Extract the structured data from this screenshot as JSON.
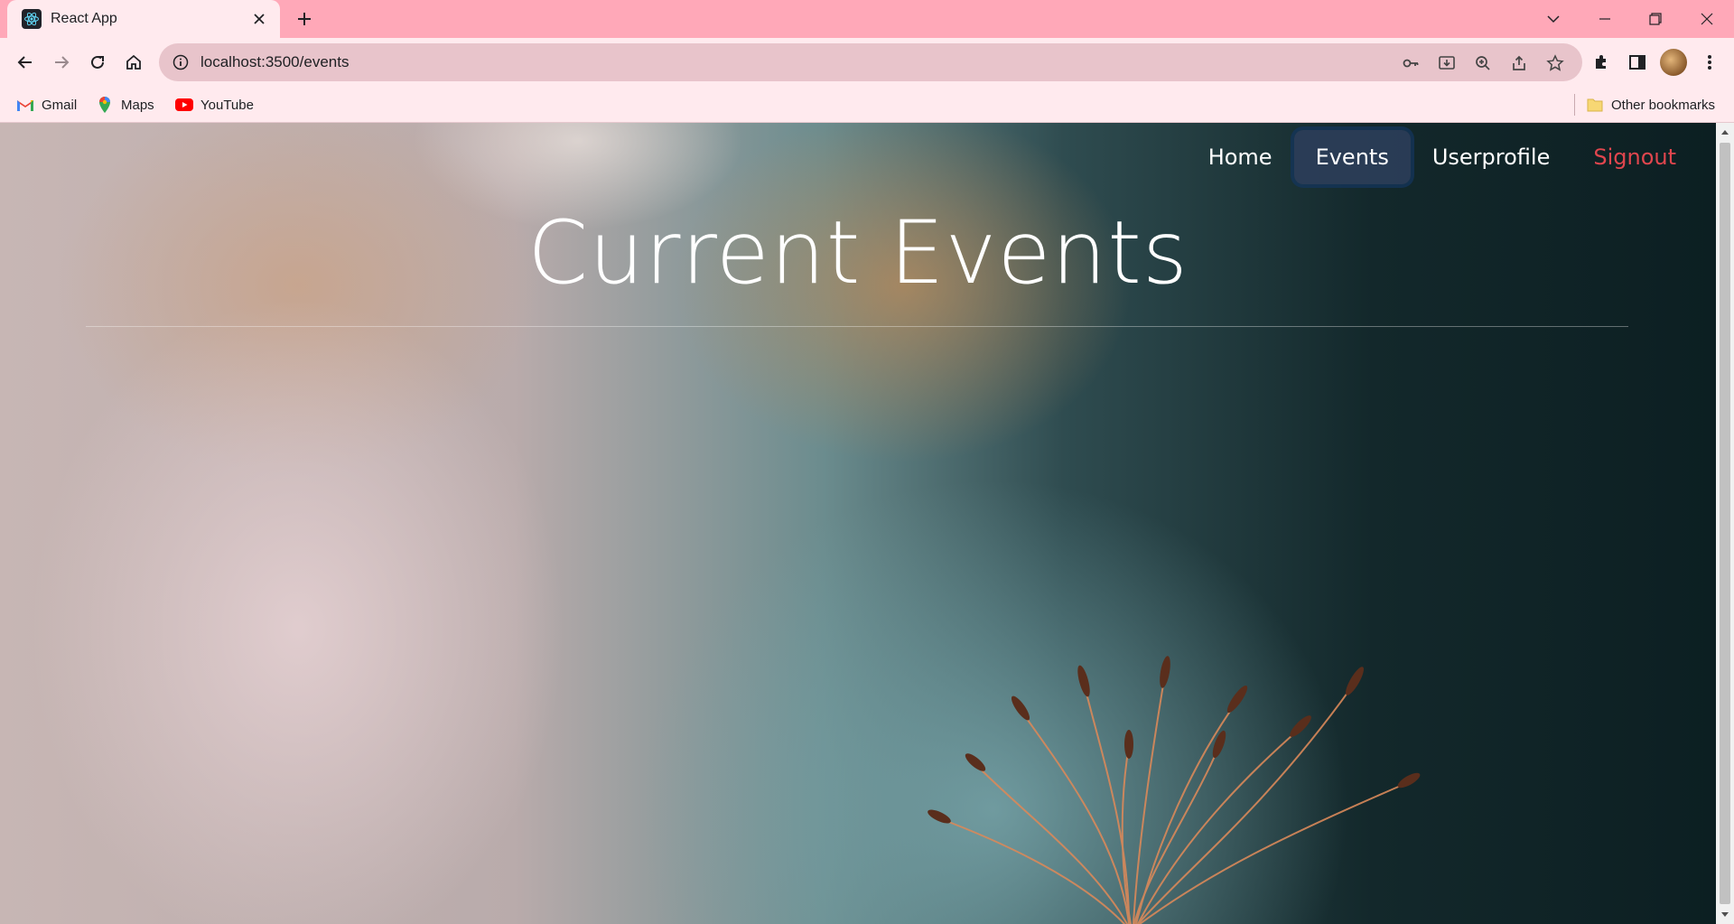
{
  "browser": {
    "tab": {
      "title": "React App"
    },
    "address_bar": {
      "url": "localhost:3500/events"
    },
    "bookmarks": [
      {
        "label": "Gmail",
        "icon": "gmail-icon"
      },
      {
        "label": "Maps",
        "icon": "maps-icon"
      },
      {
        "label": "YouTube",
        "icon": "youtube-icon"
      }
    ],
    "other_bookmarks": "Other bookmarks",
    "colors": {
      "tabstrip": "#ffa8b8",
      "toolbar": "#ffeaee",
      "omnibox": "#e8c4cb"
    }
  },
  "page": {
    "nav": [
      {
        "label": "Home",
        "state": "normal"
      },
      {
        "label": "Events",
        "state": "active"
      },
      {
        "label": "Userprofile",
        "state": "normal"
      },
      {
        "label": "Signout",
        "state": "danger"
      }
    ],
    "title": "Current Events",
    "colors": {
      "nav_active_bg": "#2c3e5a",
      "signout": "#e0464e"
    }
  }
}
